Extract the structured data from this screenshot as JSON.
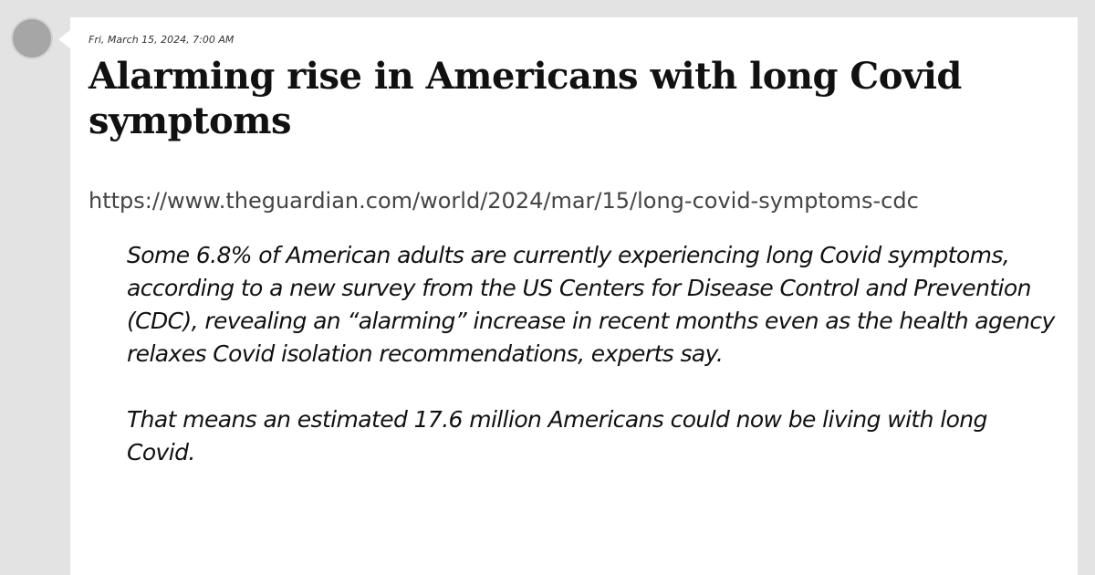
{
  "post": {
    "timestamp": "Fri, March 15, 2024, 7:00 AM",
    "headline": "Alarming rise in Americans with long Covid symptoms",
    "url": "https://www.theguardian.com/world/2024/mar/15/long-covid-symptoms-cdc",
    "quote": [
      "Some 6.8% of American adults are currently experiencing long Covid symptoms, according to a new survey from the US Centers for Disease Control and Prevention (CDC), revealing an “alarming” increase in recent months even as the health agency relaxes Covid isolation recommendations, experts say.",
      "That means an estimated 17.6 million Americans could now be living with long Covid."
    ]
  },
  "colors": {
    "page_background": "#e3e3e3",
    "card_background": "#ffffff",
    "avatar": "#a6a6a6"
  }
}
